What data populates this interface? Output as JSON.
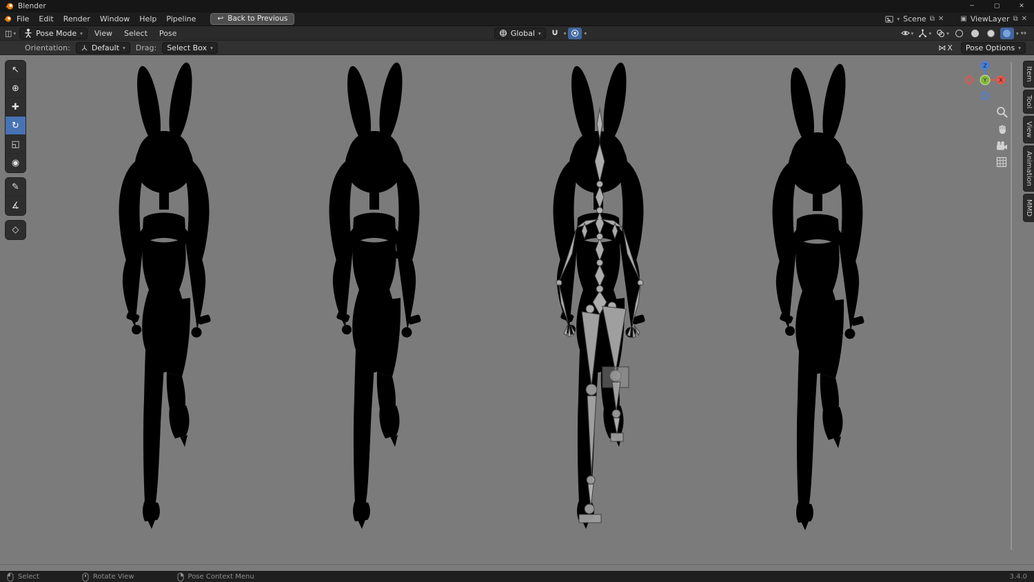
{
  "window": {
    "title": "Blender",
    "minimize": "─",
    "maximize": "▢",
    "close": "✕"
  },
  "menubar": {
    "menus": [
      "File",
      "Edit",
      "Render",
      "Window",
      "Help",
      "Pipeline"
    ],
    "back_button": "Back to Previous",
    "scene": "Scene",
    "viewlayer": "ViewLayer"
  },
  "viewport_header": {
    "mode": "Pose Mode",
    "menus": [
      "View",
      "Select",
      "Pose"
    ],
    "orientation": "Global"
  },
  "tool_settings": {
    "orientation_label": "Orientation:",
    "orientation_value": "Default",
    "drag_label": "Drag:",
    "drag_value": "Select Box",
    "mirror_x": "X",
    "pose_options": "Pose Options"
  },
  "sidebar_tabs": [
    "Item",
    "Tool",
    "View",
    "Animation",
    "MMD"
  ],
  "nav_gizmo": {
    "x": "X",
    "y": "Y",
    "z": "Z"
  },
  "statusbar": {
    "select": "Select",
    "rotate_view": "Rotate View",
    "pose_context_menu": "Pose Context Menu",
    "version": "3.4.0"
  },
  "icons": {
    "chevron": "▾",
    "back_arrow": "↩",
    "mirror": "⋈",
    "duplicate": "⧉",
    "unlink": "✕",
    "expand": "↔",
    "editor_type": "◫",
    "viewlayer_glyph": "▣",
    "tool_select": "↖",
    "tool_cursor": "⊕",
    "tool_move": "✚",
    "tool_rotate": "↻",
    "tool_scale": "◱",
    "tool_transform": "◉",
    "tool_annotate": "✎",
    "tool_measure": "∡",
    "tool_extra": "◇"
  },
  "colors": {
    "accent_blue": "#4772b3",
    "axis_x": "#e2574c",
    "axis_y": "#84b73d",
    "axis_z": "#4a7fd6",
    "viewport_bg": "#7b7b7b",
    "skin_tone": "#e9d0c4",
    "hair_pink": "#ddc6da",
    "hair_shade": "#d2b6cf",
    "suit_pink": "#d5a4ba",
    "ear_outer": "#f1e2e9",
    "ear_inner": "#eac3d3",
    "bow_pink": "#e6bed0",
    "shoe_white": "#efefef",
    "dark_mesh": "#131313"
  }
}
